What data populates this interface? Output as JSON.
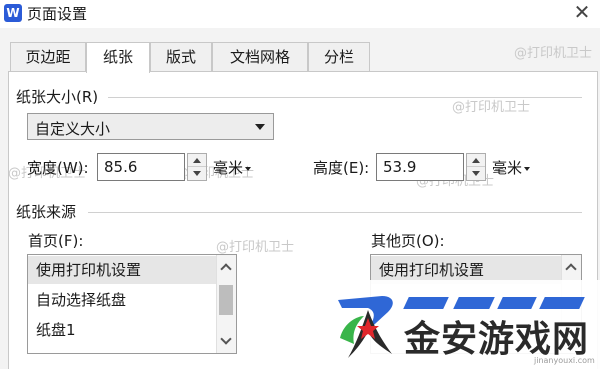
{
  "window": {
    "title": "页面设置",
    "app_icon_letter": "W",
    "close_glyph": "✕"
  },
  "tabs": [
    {
      "label": "页边距",
      "active": false
    },
    {
      "label": "纸张",
      "active": true
    },
    {
      "label": "版式",
      "active": false
    },
    {
      "label": "文档网格",
      "active": false
    },
    {
      "label": "分栏",
      "active": false
    }
  ],
  "paper_size": {
    "group_label": "纸张大小(R)",
    "selected": "自定义大小",
    "width_label": "宽度(W):",
    "width_value": "85.6",
    "height_label": "高度(E):",
    "height_value": "53.9",
    "unit": "毫米"
  },
  "paper_source": {
    "group_label": "纸张来源",
    "first_page_label": "首页(F):",
    "first_page_items": [
      "使用打印机设置",
      "自动选择纸盘",
      "纸盘1"
    ],
    "first_page_selected_index": 0,
    "other_pages_label": "其他页(O):",
    "other_pages_items": [
      "使用打印机设置"
    ]
  },
  "watermark_text": "@打印机卫士",
  "logo": {
    "text": "金安游戏网",
    "subtext": "jinanyouxi.com"
  },
  "colors": {
    "accent": "#2b5bd7",
    "logo_blue": "#2f67d6",
    "logo_red": "#e0262b",
    "logo_green": "#39b54a"
  }
}
